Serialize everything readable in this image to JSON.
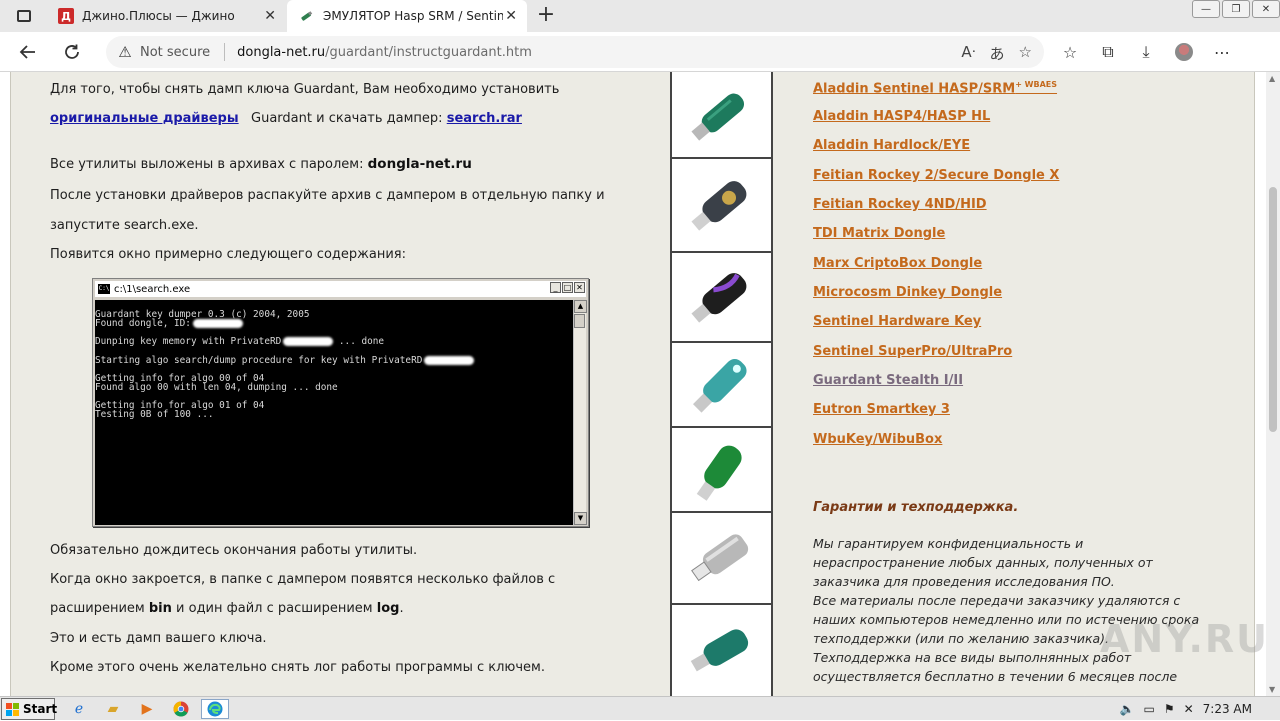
{
  "browser": {
    "tabs": [
      {
        "title": "Джино.Плюсы — Джино",
        "favicon_letter": "Д",
        "active": false
      },
      {
        "title": "ЭМУЛЯТОР Hasp SRM / Sentinel",
        "active": true
      }
    ],
    "address": {
      "security_label": "Not secure",
      "host": "dongla-net.ru",
      "path": "/guardant/instructguardant.htm"
    }
  },
  "content": {
    "p1_text": "Для того, чтобы снять дамп ключа Guardant, Вам необходимо установить",
    "p1_link_drivers": "оригинальные драйверы",
    "p1_mid": "Guardant и скачать дампер:",
    "p1_link_search": "search.rar",
    "p2_text": "Все утилиты выложены в архивах с паролем:",
    "p2_password": "dongla-net.ru",
    "p3_line1": "После установки драйверов распакуйте архив с дампером в отдельную папку и",
    "p3_line2": "запустите search.exe.",
    "p4_text": "Появится окно примерно следующего содержания:",
    "p5_text": "Обязательно дождитесь окончания работы утилиты.",
    "p6_line1": "Когда окно закроется, в папке с дампером появятся несколько файлов с",
    "p6_pre": "расширением",
    "p6_bin": "bin",
    "p6_mid": "и один файл с расширением",
    "p6_log": "log",
    "p6_end": ".",
    "p7_text": "Это и есть дамп вашего ключа.",
    "p8_text": "Кроме этого очень желательно  снять лог работы программы с ключем."
  },
  "console": {
    "title": "c:\\1\\search.exe",
    "lines": {
      "l1": "Guardant key dumper 0.3 (c) 2004, 2005",
      "l2": "Found dongle, ID:",
      "l3a": "Dunping key memory with PrivateRD",
      "l3b": " ... done",
      "l4": "Starting algo search/dump procedure for key with PrivateRD",
      "l5": "Getting info for algo 00 of 04",
      "l6": "Found algo 00 with len 04, dumping ... done",
      "l7": "Getting info for algo 01 of 04",
      "l8": "Testing 0B of 100 ..."
    }
  },
  "menu": {
    "items": [
      {
        "label": "Aladdin Sentinel HASP/SRM",
        "suffix": "+ WBAES"
      },
      {
        "label": "Aladdin HASP4/HASP HL"
      },
      {
        "label": "Aladdin Hardlock/EYE"
      },
      {
        "label": "Feitian Rockey 2/Secure Dongle X"
      },
      {
        "label": "Feitian Rockey 4ND/HID"
      },
      {
        "label": "TDI Matrix Dongle"
      },
      {
        "label": "Marx CriptoBox Dongle"
      },
      {
        "label": "Microcosm Dinkey Dongle"
      },
      {
        "label": "Sentinel Hardware Key"
      },
      {
        "label": "Sentinel SuperPro/UltraPro"
      },
      {
        "label": "Guardant Stealth I/II"
      },
      {
        "label": "Eutron Smartkey 3"
      },
      {
        "label": "WbuKey/WibuBox"
      }
    ]
  },
  "guarantee": {
    "heading": "Гарантии и техподдержка.",
    "lines": [
      "Мы гарантируем конфиденциальность и",
      "нераспространение любых данных, полученных от",
      "заказчика для проведения исследования ПО.",
      "Все материалы после передачи заказчику удаляются с",
      "наших компьютеров немедленно или по истечению срока",
      "техподдержки (или по желанию заказчика).",
      "Техподдержка на все виды выполнянных работ",
      "осуществляется бесплатно в течении 6 месяцев после"
    ]
  },
  "watermark": "ANY.RUN",
  "taskbar": {
    "start_label": "Start",
    "clock": "7:23 AM"
  },
  "colors": {
    "link_orange": "#c4691c",
    "link_visited": "#7a6a7e",
    "link_blue": "#1a1aa8",
    "page_bg": "#ecebe4"
  }
}
